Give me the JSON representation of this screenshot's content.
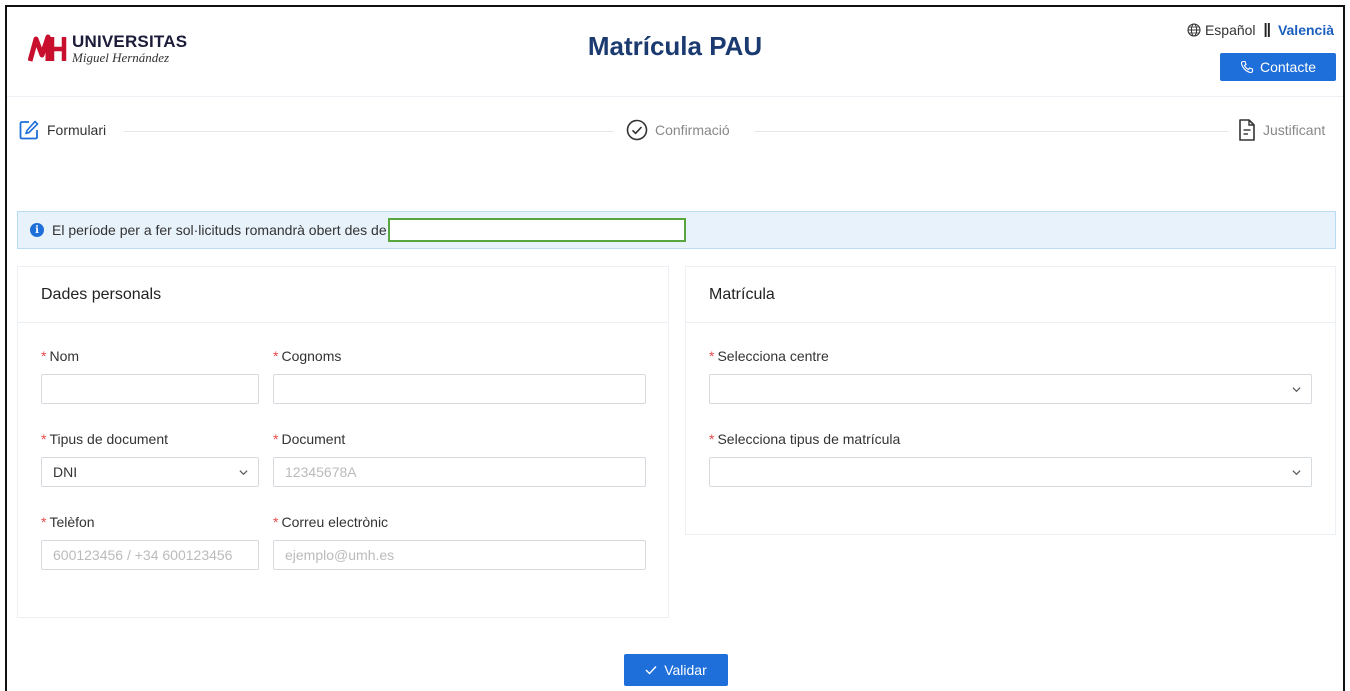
{
  "header": {
    "logo": {
      "title": "UNIVERSITAS",
      "subtitle": "Miguel Hernández"
    },
    "title": "Matrícula PAU",
    "languages": {
      "es": "Español",
      "separator": "||",
      "va": "Valencià"
    },
    "contact_label": "Contacte"
  },
  "steps": [
    {
      "label": "Formulari",
      "icon": "edit-icon",
      "active": true
    },
    {
      "label": "Confirmació",
      "icon": "check-circle-icon",
      "active": false
    },
    {
      "label": "Justificant",
      "icon": "document-icon",
      "active": false
    }
  ],
  "alert": {
    "text": "El període per a fer sol·licituds romandrà obert des de",
    "date_value": ""
  },
  "personal": {
    "title": "Dades personals",
    "fields": {
      "nom": {
        "label": "Nom",
        "value": "",
        "placeholder": ""
      },
      "cognoms": {
        "label": "Cognoms",
        "value": "",
        "placeholder": ""
      },
      "tipus_document": {
        "label": "Tipus de document",
        "value": "DNI"
      },
      "document": {
        "label": "Document",
        "placeholder": "12345678A"
      },
      "telefon": {
        "label": "Telèfon",
        "placeholder": "600123456 / +34 600123456"
      },
      "correu": {
        "label": "Correu electrònic",
        "placeholder": "ejemplo@umh.es"
      }
    }
  },
  "matricula": {
    "title": "Matrícula",
    "fields": {
      "centre": {
        "label": "Selecciona centre",
        "value": ""
      },
      "tipus": {
        "label": "Selecciona tipus de matrícula",
        "value": ""
      }
    }
  },
  "actions": {
    "validate_label": "Validar"
  },
  "colors": {
    "accent": "#1e6fd9",
    "title": "#1a3a70",
    "required": "#e84b4b",
    "alert_bg": "#e8f2fb",
    "highlight": "#5aa63e"
  }
}
